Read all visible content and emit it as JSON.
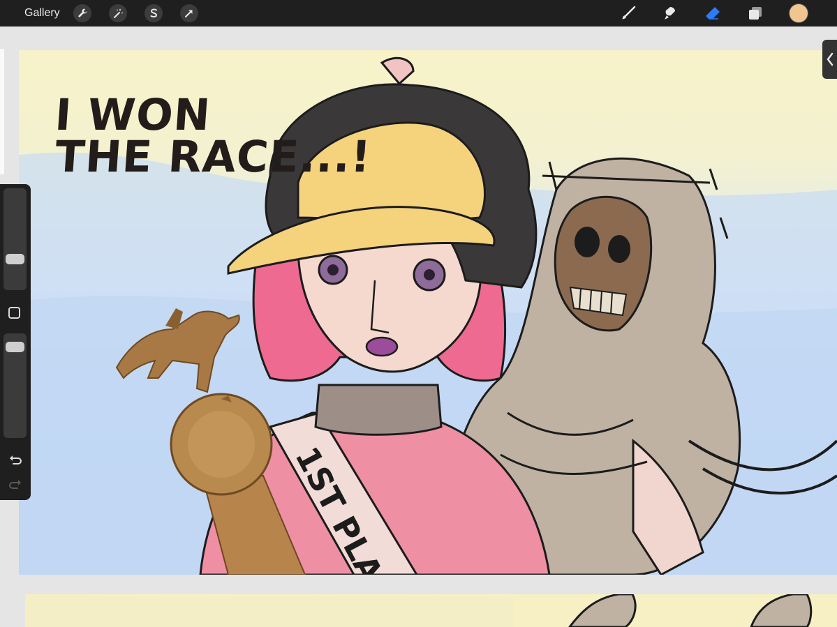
{
  "toolbar": {
    "gallery_label": "Gallery",
    "left_tools": [
      "wrench-icon",
      "magic-wand-icon",
      "selection-s-icon",
      "arrow-transform-icon"
    ],
    "right_tools": [
      "brush-icon",
      "smudge-icon",
      "eraser-icon",
      "layers-icon"
    ],
    "active_tool": "eraser-icon",
    "color": "#f0c58f"
  },
  "sidebar": {
    "brush_size_level": 0.27,
    "opacity_level": 0.93
  },
  "artwork": {
    "caption_line1": "I WON",
    "caption_line2": "THE RACE...!",
    "sash_text": "1ST PLA"
  },
  "colors": {
    "toolbar_bg": "#1f1f1f",
    "eraser_active": "#2f7bf6",
    "canvas_sky": "#c8ddf7",
    "canvas_cream": "#f7f2c8"
  }
}
